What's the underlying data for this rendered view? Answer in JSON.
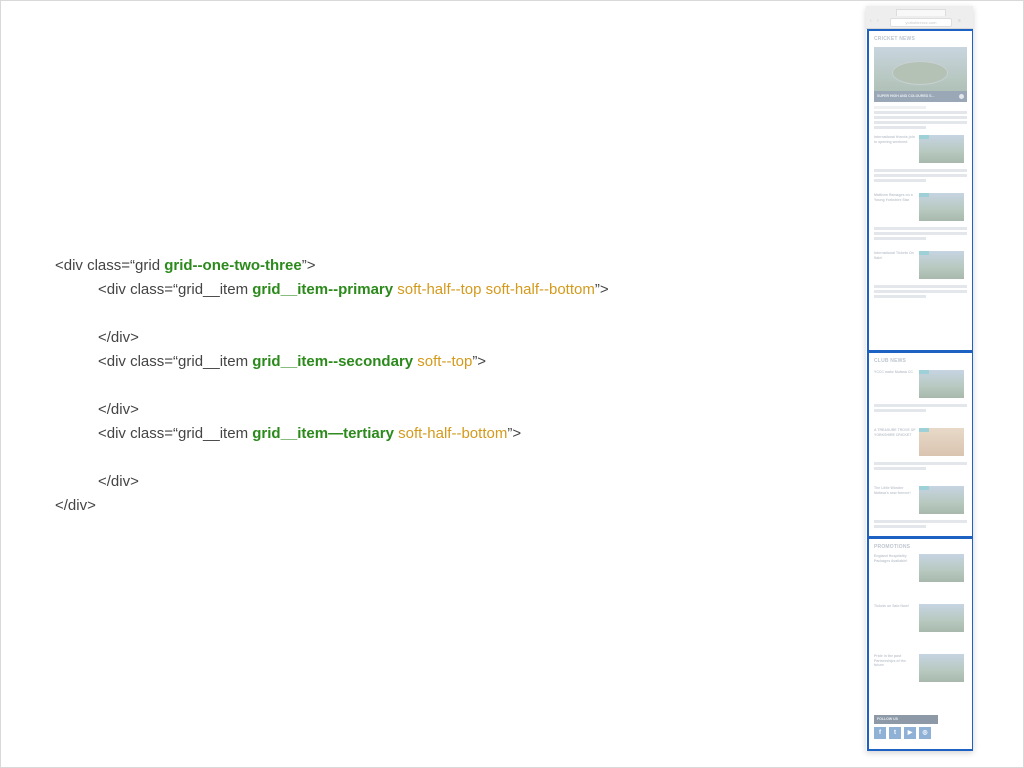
{
  "code": {
    "line1": {
      "a": "<div class=“grid ",
      "b": "grid--one-two-three",
      "c": "”>"
    },
    "line2": {
      "a": "<div class=“grid__item ",
      "b": "grid__item--primary",
      "c": " soft-half--top soft-half--bottom",
      "d": "”>"
    },
    "line3": "</div>",
    "line4": {
      "a": "<div class=“grid__item ",
      "b": "grid__item--secondary",
      "c": " soft--top",
      "d": "”>"
    },
    "line5": "</div>",
    "line6": {
      "a": "<div class=“grid__item ",
      "b": "grid__item—tertiary",
      "c": " soft-half--bottom",
      "d": "”>"
    },
    "line7": "</div>",
    "line8": "</div>"
  },
  "mockup": {
    "browser_url": "yorkshireccc.com",
    "sections": {
      "news_title": "CRICKET NEWS",
      "hero_caption": "SUPER HIGH AND COLOURED S...",
      "club_title": "CLUB NEWS",
      "promo_title": "PROMOTIONS",
      "follow_label": "FOLLOW US"
    },
    "news_stories": [
      "International friends join in opening weekend",
      "Matthew Ramages on a Young Yorkshire Star",
      "International Tickets On Sale!"
    ],
    "club_stories": [
      "YCCC make Mufasa CC",
      "A TREASURE TROVE OF YORKSHIRE CRICKET",
      "The Little Wonder Mufasa's new forever!"
    ],
    "promo_stories": [
      "England Hospitality Packages Available!",
      "Tickets on Sale Now!",
      "Pride in the past Partnerships of the future"
    ],
    "social_icons": [
      "facebook-icon",
      "twitter-icon",
      "youtube-icon",
      "instagram-icon"
    ],
    "colors": {
      "section_border": "#1d62c2",
      "code_class_highlight": "#2b8a1b",
      "code_modifier": "#d49a1c"
    }
  }
}
